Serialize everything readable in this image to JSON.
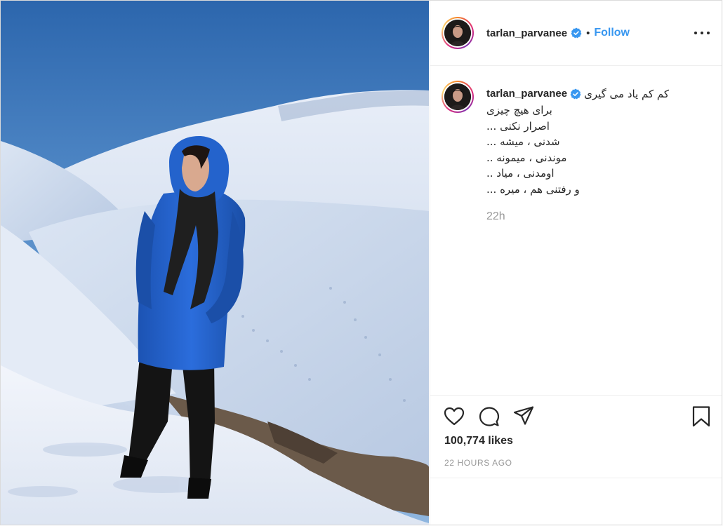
{
  "post": {
    "username": "tarlan_parvanee",
    "verified": true,
    "follow_label": "Follow",
    "separator": "•"
  },
  "caption": {
    "username": "tarlan_parvanee",
    "first_line": "کم کم یاد می گیری",
    "lines": [
      "برای هیچ چیزی",
      "اصرار نکنی ...",
      "شدنی ، میشه ...",
      "موندنی ، میمونه ..",
      "اومدنی ، میاد ..",
      "و رفتنی هم ، میره ..."
    ],
    "time": "22h"
  },
  "engagement": {
    "likes": "100,774 likes",
    "time_ago": "22 HOURS AGO"
  },
  "icons": {
    "like": "heart-icon",
    "comment": "comment-bubble-icon",
    "share": "paper-plane-icon",
    "save": "bookmark-icon",
    "more": "more-options-icon",
    "verified": "verified-badge-icon"
  },
  "colors": {
    "follow": "#3897f0",
    "verified": "#3897f0",
    "muted": "#999999",
    "text": "#262626"
  }
}
